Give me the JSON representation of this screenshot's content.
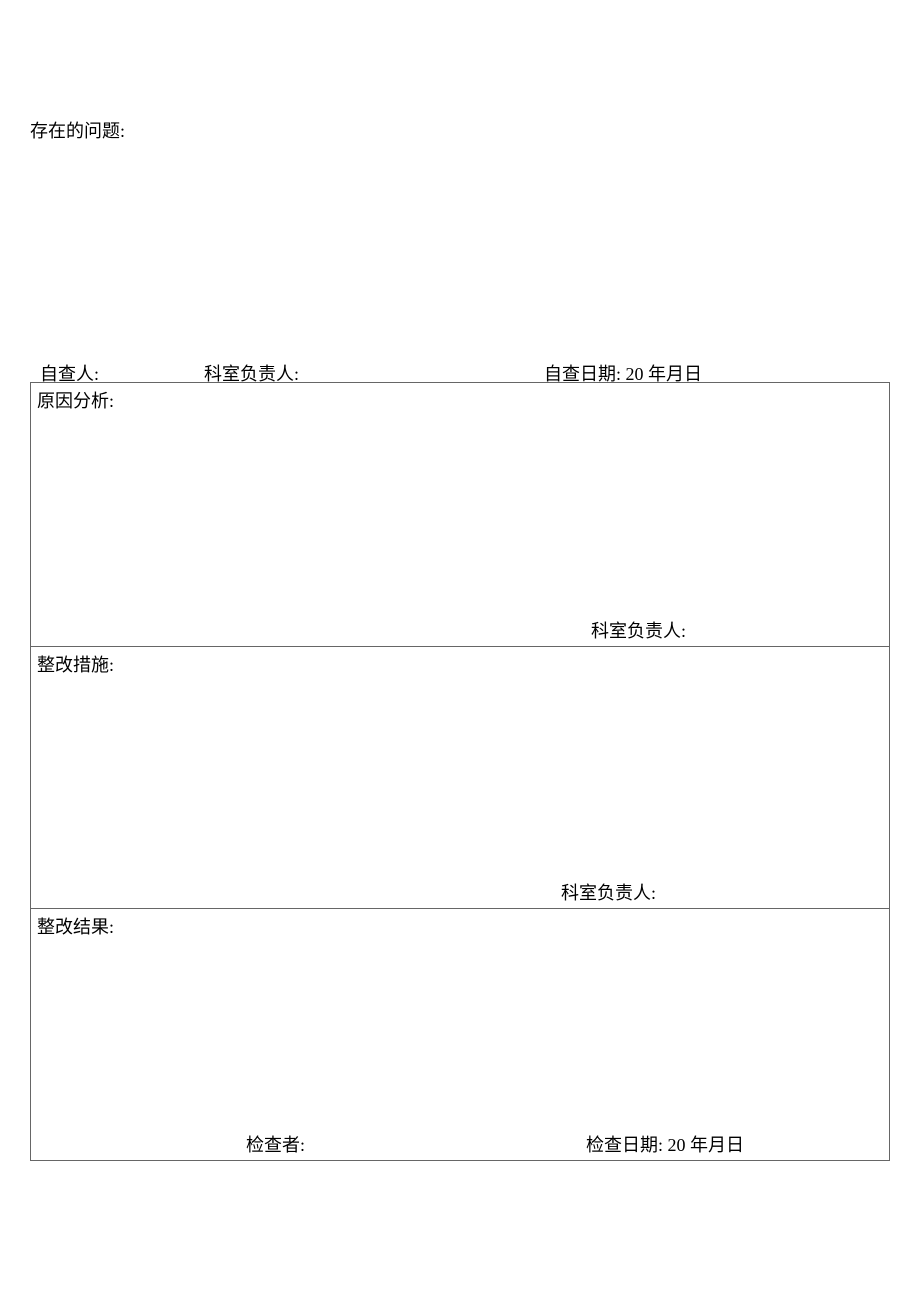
{
  "problems": {
    "title": "存在的问题:"
  },
  "inspection_row": {
    "inspector": "自查人:",
    "department_head": "科室负责人:",
    "date": "自查日期: 20 年月日"
  },
  "cause_analysis": {
    "title": "原因分析:",
    "footer": "科室负责人:"
  },
  "corrective_measures": {
    "title": "整改措施:",
    "footer": "科室负责人:"
  },
  "corrective_results": {
    "title": "整改结果:",
    "footer_checker": "检查者:",
    "footer_date": "检查日期: 20 年月日"
  }
}
